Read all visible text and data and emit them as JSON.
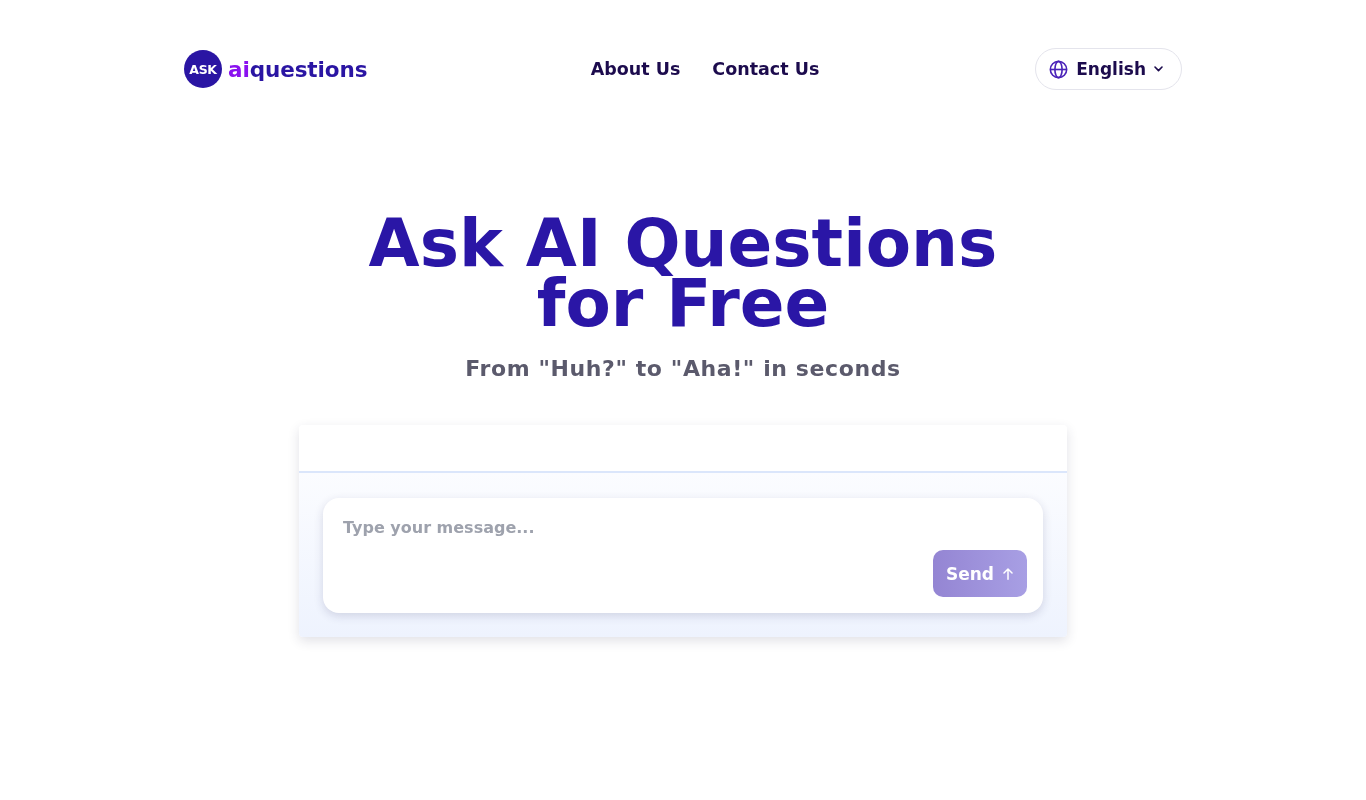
{
  "header": {
    "logo": {
      "badge": "ASK",
      "name_prefix": "ai",
      "name_rest": "questions"
    },
    "nav": [
      "About Us",
      "Contact Us"
    ],
    "language": {
      "label": "English"
    }
  },
  "hero": {
    "title": "Ask AI Questions for Free",
    "subtitle": "From \"Huh?\" to \"Aha!\" in seconds"
  },
  "chat": {
    "input": {
      "placeholder": "Type your message..."
    },
    "send_button": {
      "label": "Send"
    }
  }
}
